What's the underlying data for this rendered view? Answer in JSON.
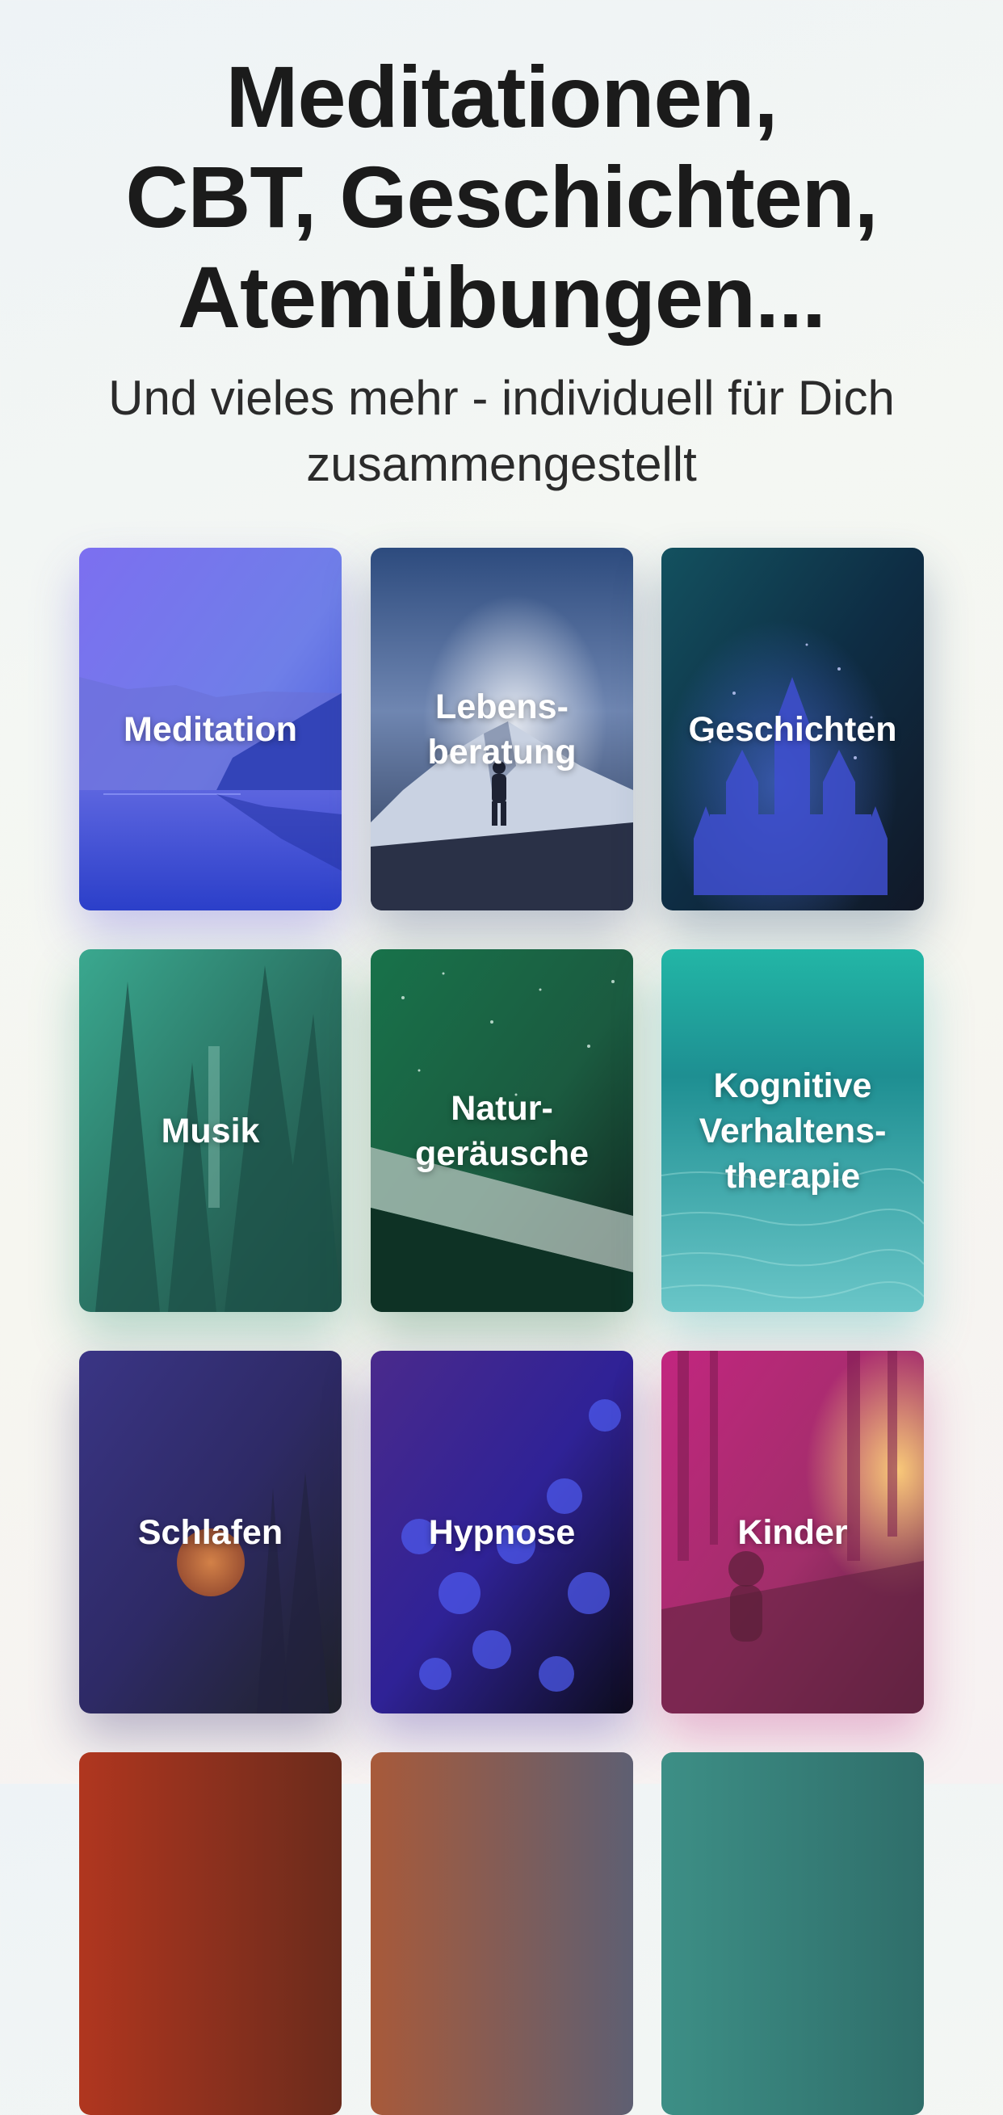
{
  "header": {
    "title_lines": [
      "Meditationen,",
      "CBT, Geschichten,",
      "Atemübungen..."
    ],
    "subtitle_lines": [
      "Und vieles mehr - individuell für Dich",
      "zusammengestellt"
    ]
  },
  "categories": [
    {
      "label": "Meditation",
      "icon": "mountain-lake-image"
    },
    {
      "label": "Lebens-\nberatung",
      "icon": "hiker-mountain-image"
    },
    {
      "label": "Geschichten",
      "icon": "castle-image"
    },
    {
      "label": "Musik",
      "icon": "forest-waterfall-image"
    },
    {
      "label": "Natur-\ngeräusche",
      "icon": "rain-image"
    },
    {
      "label": "Kognitive\nVerhaltens-\ntherapie",
      "icon": "water-image"
    },
    {
      "label": "Schlafen",
      "icon": "moon-image"
    },
    {
      "label": "Hypnose",
      "icon": "flowers-image"
    },
    {
      "label": "Kinder",
      "icon": "girl-sunlight-image"
    }
  ],
  "colors": {
    "text_dark": "#1b1b1b",
    "meditation": "#7c6fe6",
    "lebensberatung": "#3b5a8c",
    "geschichten": "#0f4a57",
    "musik": "#2c8a78",
    "naturgeraeusche": "#1e6a4c",
    "kvt": "#30c3b4",
    "schlafen": "#3a2c7a",
    "hypnose": "#3c2aa8",
    "kinder": "#d23a8a"
  }
}
